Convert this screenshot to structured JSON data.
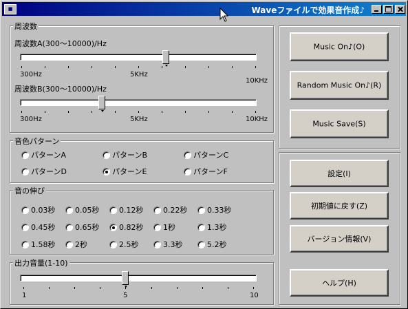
{
  "window": {
    "title": "Waveファイルで効果音作成♪",
    "app_icon": "■"
  },
  "freq": {
    "legend": "周波数",
    "a_label": "周波数A(300〜10000)/Hz",
    "b_label": "周波数B(300〜10000)/Hz",
    "a_value_hz": 6300,
    "b_value_hz": 3600,
    "min_label": "300Hz",
    "mid_label": "5KHz",
    "max_label": "10KHz"
  },
  "timbre": {
    "legend": "音色パターン",
    "options": [
      "パターンA",
      "パターンB",
      "パターンC",
      "パターンD",
      "パターンE",
      "パターンF"
    ],
    "selected": "パターンE"
  },
  "duration": {
    "legend": "音の伸び",
    "options": [
      "0.03秒",
      "0.05秒",
      "0.12秒",
      "0.22秒",
      "0.33秒",
      "0.45秒",
      "0.65秒",
      "0.82秒",
      "1秒",
      "1.3秒",
      "1.58秒",
      "2秒",
      "2.5秒",
      "3.3秒",
      "5.2秒"
    ],
    "selected": "0.82秒"
  },
  "volume": {
    "legend": "出力音量(1-10)",
    "value": 5,
    "min_label": "1",
    "mid_label": "5",
    "max_label": "10"
  },
  "buttons": {
    "music_on": "Music On♪(O)",
    "random_music_on": "Random Music On♪(R)",
    "music_save": "Music Save(S)",
    "settings": "設定(I)",
    "reset": "初期値に戻す(Z)",
    "version": "バージョン情報(V)",
    "help": "ヘルプ(H)"
  }
}
